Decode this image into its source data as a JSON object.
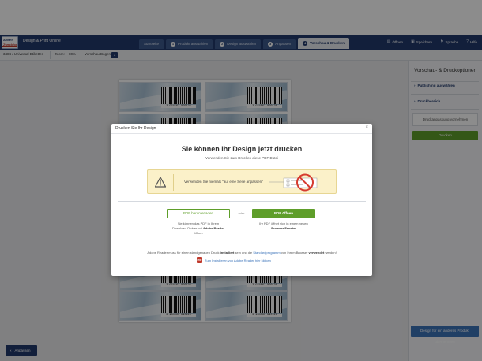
{
  "header": {
    "logo_line1": "AVERY",
    "logo_line2": "Zweckform",
    "app_title": "Design & Print Online",
    "steps": [
      {
        "num": "",
        "label": "Startseite"
      },
      {
        "num": "1",
        "label": "Produkt auswählen"
      },
      {
        "num": "2",
        "label": "Design auswählen"
      },
      {
        "num": "3",
        "label": "Anpassen"
      },
      {
        "num": "4",
        "label": "Vorschau & Drucken"
      }
    ],
    "actions": [
      {
        "icon": "▤",
        "label": "Öffnen"
      },
      {
        "icon": "▣",
        "label": "Speichern"
      },
      {
        "icon": "⚑",
        "label": "Sprache"
      },
      {
        "icon": "?",
        "label": "Hilfe"
      }
    ]
  },
  "toolbar": {
    "product": "3484 / Universal Etiketten",
    "zoom_label": "Zoom:",
    "zoom_value": "80%",
    "sheet_label": "Vorschau Bogen:",
    "sheet_number": "1"
  },
  "labels": {
    "barcode_text": "3 934567 890126"
  },
  "right_panel": {
    "title": "Vorschau- & Druckoptionen",
    "link_publishing": "Publishing auswählen",
    "link_print_range": "Druckbereich",
    "adjust_box": "Druckanpassung vornehmen",
    "print_button": "Drucken",
    "other_product_button": "Design für ein anderes Produkt übernehmen"
  },
  "back_button": "Anpassen",
  "modal": {
    "title": "Drucken Sie Ihr Design",
    "close": "×",
    "heading": "Sie können Ihr Design jetzt drucken",
    "subheading": "Verwenden Sie zum Drucken diese PDF Datei",
    "warning": "Verwenden Sie niemals \"auf eine Seite anpassen\"",
    "download_button": "PDF herunterladen",
    "or": "- oder -",
    "open_button": "PDF öffnen",
    "download_desc_1": "Sie können das PDF in Ihrem",
    "download_desc_2": "Download Ordner mit",
    "download_desc_bold": "Adobe Reader",
    "download_desc_3": "öffnen",
    "open_desc_1": "Ihr PDF öffnet sich in einem neuen",
    "open_desc_bold": "Browser Fenster",
    "note_1": "Adobe Reader muss für einen standgenauen Druck",
    "note_bold": "installiert",
    "note_2": "sein und die",
    "note_link": "Standardprogramm",
    "note_3": "von Ihrem Browser",
    "note_bold2": "verwendet",
    "note_4": "werden!",
    "install_link": "Zum Installieren von Adobe Reader hier klicken",
    "pdf_icon": "PDF"
  }
}
